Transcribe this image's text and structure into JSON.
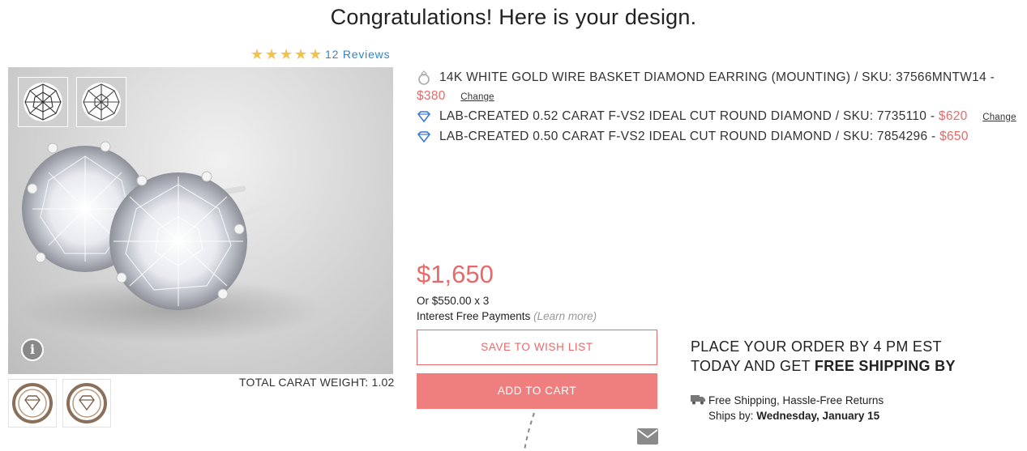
{
  "page": {
    "heading": "Congratulations! Here is your design."
  },
  "rating": {
    "stars": 5,
    "reviews_label": "12 Reviews",
    "star_color": "#f2c14e"
  },
  "gallery": {
    "total_carat_label": "TOTAL CARAT WEIGHT: 1.02",
    "info_icon": "info-icon"
  },
  "items": [
    {
      "icon": "ring-icon",
      "text": "14K WHITE GOLD WIRE BASKET DIAMOND EARRING (MOUNTING) / SKU: 37566MNTW14 -",
      "price": "$380",
      "change_label": "Change"
    },
    {
      "icon": "diamond-icon",
      "text": "LAB-CREATED 0.52 CARAT F-VS2 IDEAL CUT ROUND DIAMOND / SKU: 7735110 -",
      "price": "$620",
      "change_label": "Change"
    },
    {
      "icon": "diamond-icon",
      "text": "LAB-CREATED 0.50 CARAT F-VS2 IDEAL CUT ROUND DIAMOND / SKU: 7854296 -",
      "price": "$650"
    }
  ],
  "pricing": {
    "total": "$1,650",
    "installment": "Or $550.00 x 3",
    "interest_free": "Interest Free Payments",
    "learn_more": "(Learn more)"
  },
  "actions": {
    "wishlist_label": "SAVE TO WISH LIST",
    "add_to_cart_label": "ADD TO CART"
  },
  "shipping": {
    "order_line1": "PLACE YOUR ORDER BY 4 PM EST",
    "order_line2_prefix": "TODAY AND GET ",
    "order_line2_bold": "FREE SHIPPING BY",
    "free_shipping": "Free Shipping, Hassle-Free Returns",
    "ships_by_label": "Ships by: ",
    "ships_by_date": "Wednesday, January 15"
  },
  "colors": {
    "accent": "#e66a6a",
    "cart_button": "#ef7e7e",
    "link": "#2f86c6"
  }
}
